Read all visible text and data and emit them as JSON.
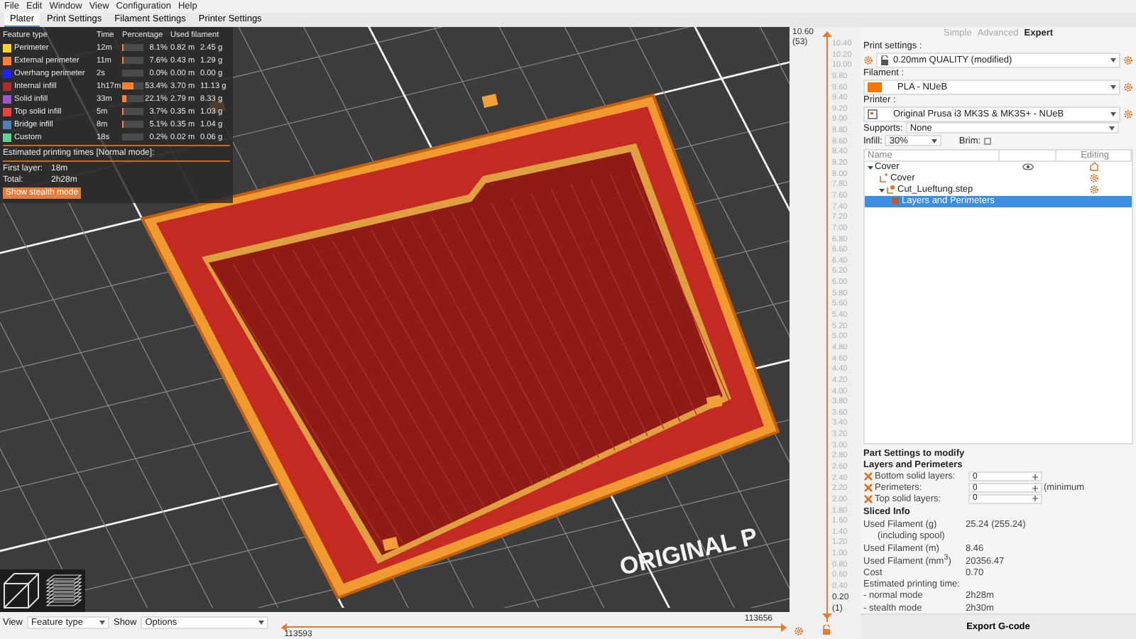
{
  "menu": [
    "File",
    "Edit",
    "Window",
    "View",
    "Configuration",
    "Help"
  ],
  "tabs": [
    {
      "label": "Plater",
      "selected": true
    },
    {
      "label": "Print Settings",
      "selected": false
    },
    {
      "label": "Filament Settings",
      "selected": false
    },
    {
      "label": "Printer Settings",
      "selected": false
    }
  ],
  "legend": {
    "headers": [
      "Feature type",
      "Time",
      "Percentage",
      "Used filament"
    ],
    "rows": [
      {
        "name": "Perimeter",
        "color": "#f5d327",
        "time": "12m",
        "level": 0.081,
        "percentage": "8.1%",
        "length": "0.82 m",
        "weight": "2.45 g"
      },
      {
        "name": "External perimeter",
        "color": "#ff7d38",
        "time": "11m",
        "level": 0.076,
        "percentage": "7.6%",
        "length": "0.43 m",
        "weight": "1.29 g"
      },
      {
        "name": "Overhang perimeter",
        "color": "#1f1fff",
        "time": "2s",
        "level": 0.0,
        "percentage": "0.0%",
        "length": "0.00 m",
        "weight": "0.00 g"
      },
      {
        "name": "Internal infill",
        "color": "#b02c2c",
        "time": "1h17m",
        "level": 0.534,
        "percentage": "53.4%",
        "length": "3.70 m",
        "weight": "11.13 g"
      },
      {
        "name": "Solid infill",
        "color": "#9a55cf",
        "time": "33m",
        "level": 0.221,
        "percentage": "22.1%",
        "length": "2.79 m",
        "weight": "8.33 g"
      },
      {
        "name": "Top solid infill",
        "color": "#f04040",
        "time": "5m",
        "level": 0.037,
        "percentage": "3.7%",
        "length": "0.35 m",
        "weight": "1.03 g"
      },
      {
        "name": "Bridge infill",
        "color": "#4d80ba",
        "time": "8m",
        "level": 0.051,
        "percentage": "5.1%",
        "length": "0.35 m",
        "weight": "1.04 g"
      },
      {
        "name": "Custom",
        "color": "#5ed194",
        "time": "18s",
        "level": 0.002,
        "percentage": "0.2%",
        "length": "0.02 m",
        "weight": "0.06 g"
      }
    ],
    "times_title": "Estimated printing times [Normal mode]:",
    "first_layer": {
      "label": "First layer:",
      "value": "18m"
    },
    "total": {
      "label": "Total:",
      "value": "2h28m"
    },
    "stealth_button": "Show stealth mode"
  },
  "scene": {
    "bed_label": "ORIGINAL P"
  },
  "bottom_bar": {
    "view_label": "View",
    "view_value": "Feature type",
    "show_label": "Show",
    "show_value": "Options",
    "slider": {
      "max": "113656",
      "min": "113593",
      "level": 1
    }
  },
  "layer_slider": {
    "top_value": "10.60",
    "top_layer": "(53)",
    "bottom_value": "0.20",
    "bottom_layer": "(1)",
    "ticks": [
      "10.40",
      "10.20",
      "10.00",
      "9.80",
      "9.60",
      "9.40",
      "9.20",
      "9.00",
      "8.80",
      "8.60",
      "8.40",
      "8.20",
      "8.00",
      "7.80",
      "7.60",
      "7.40",
      "7.20",
      "7.00",
      "6.80",
      "6.60",
      "6.40",
      "6.20",
      "6.00",
      "5.80",
      "5.60",
      "5.40",
      "5.20",
      "5.00",
      "4.80",
      "4.60",
      "4.40",
      "4.20",
      "4.00",
      "3.80",
      "3.60",
      "3.40",
      "3.20",
      "3.00",
      "2.80",
      "2.60",
      "2.40",
      "2.20",
      "2.00",
      "1.80",
      "1.60",
      "1.40",
      "1.20",
      "1.00",
      "0.80",
      "0.60",
      "0.40"
    ]
  },
  "sidebar": {
    "modes": [
      {
        "label": "Simple",
        "selected": false
      },
      {
        "label": "Advanced",
        "selected": false
      },
      {
        "label": "Expert",
        "selected": true
      }
    ],
    "print_settings": {
      "label": "Print settings :",
      "value": "0.20mm QUALITY (modified)"
    },
    "filament": {
      "label": "Filament :",
      "value": "PLA - NUeB",
      "color": "#f07800"
    },
    "printer": {
      "label": "Printer :",
      "value": "Original Prusa i3 MK3S & MK3S+ - NUeB"
    },
    "supports": {
      "label": "Supports:",
      "value": "None"
    },
    "infill": {
      "label": "Infill:",
      "value": "30%"
    },
    "brim": {
      "label": "Brim:",
      "checked": false
    },
    "object_list": {
      "columns": [
        "Name",
        "Editing"
      ],
      "items": [
        {
          "label": "Cover",
          "kind": "object",
          "expanded": true,
          "selected": false,
          "children": [
            {
              "label": "Cover",
              "kind": "part",
              "selected": false
            },
            {
              "label": "Cut_Lueftung.step",
              "kind": "modifier",
              "expanded": true,
              "selected": false,
              "children": [
                {
                  "label": "Layers and Perimeters",
                  "kind": "settings",
                  "selected": true
                }
              ]
            }
          ]
        }
      ]
    },
    "part_settings": {
      "title": "Part Settings to modify",
      "group": "Layers and Perimeters",
      "rows": [
        {
          "label": "Bottom solid layers:",
          "value": "0"
        },
        {
          "label": "Perimeters:",
          "value": "0",
          "note": "(minimum"
        },
        {
          "label": "Top solid layers:",
          "value": "0"
        }
      ]
    },
    "sliced_info": {
      "title": "Sliced Info",
      "rows": [
        {
          "kind": "row",
          "label": "Used Filament (g)",
          "value": "25.24 (255.24)"
        },
        {
          "kind": "sub",
          "label": "(including spool)"
        },
        {
          "kind": "row",
          "label": "Used Filament (m)",
          "value": "8.46"
        },
        {
          "kind": "row",
          "label": "Used Filament (mm$^{3}$)",
          "value": "20356.47"
        },
        {
          "kind": "row",
          "label": "Cost",
          "value": "0.70"
        },
        {
          "kind": "row",
          "label": "Estimated printing time:"
        },
        {
          "kind": "row",
          "label": " - normal mode",
          "value": "2h28m"
        },
        {
          "kind": "row",
          "label": " - stealth mode",
          "value": "2h30m"
        }
      ]
    },
    "export_button": "Export G-code"
  }
}
